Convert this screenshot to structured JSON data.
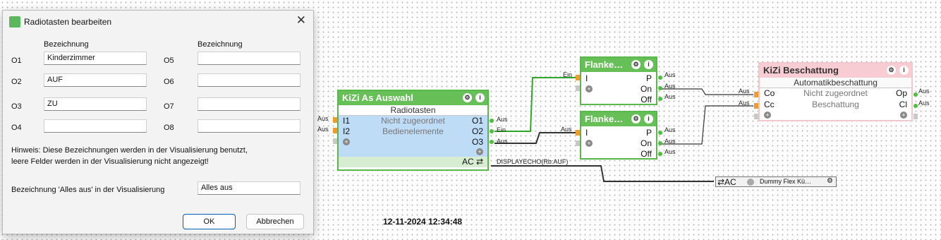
{
  "dialog": {
    "title": "Radiotasten bearbeiten",
    "close": "✕",
    "col_header_left": "Bezeichnung",
    "col_header_right": "Bezeichnung",
    "rows_left": [
      {
        "label": "O1",
        "value": "Kinderzimmer"
      },
      {
        "label": "O2",
        "value": "AUF"
      },
      {
        "label": "O3",
        "value": "ZU"
      },
      {
        "label": "O4",
        "value": ""
      }
    ],
    "rows_right": [
      {
        "label": "O5",
        "value": ""
      },
      {
        "label": "O6",
        "value": ""
      },
      {
        "label": "O7",
        "value": ""
      },
      {
        "label": "O8",
        "value": ""
      }
    ],
    "hint_line1": "Hinweis: Diese Bezeichnungen werden in der Visualisierung benutzt,",
    "hint_line2": "leere Felder werden in der Visualisierung nicht angezeigt!",
    "all_off_label": "Bezeichnung 'Alles aus' in der Visualisierung",
    "all_off_value": "Alles aus",
    "ok_label": "OK",
    "cancel_label": "Abbrechen"
  },
  "blocks": {
    "auswahl": {
      "title": "KiZi As Auswahl",
      "subtitle": "Radiotasten",
      "in1": "I1",
      "in2": "I2",
      "center1": "Nicht zugeordnet",
      "center2": "Bedienelemente",
      "out1": "O1",
      "out2": "O2",
      "out3": "O3",
      "ac": "AC ⇄",
      "ext_in1": "Aus",
      "ext_in2": "Aus",
      "ext_out1": "Aus",
      "ext_out2": "Ein",
      "ext_out3": "Aus",
      "echo": "DISPLAYECHO(Rb:AUF)"
    },
    "flanke1": {
      "title": "Flanke…",
      "in": "I",
      "out1": "P",
      "out2": "On",
      "out3": "Off",
      "ext_in": "Ein",
      "ext_out1": "Aus",
      "ext_out2": "Aus",
      "ext_out3": "Aus"
    },
    "flanke2": {
      "title": "Flanke…",
      "in": "I",
      "out1": "P",
      "out2": "On",
      "out3": "Off",
      "ext_in": "Aus",
      "ext_out1": "Aus",
      "ext_out2": "Aus",
      "ext_out3": "Aus"
    },
    "beschattung": {
      "title": "KiZi Beschattung",
      "subtitle": "Automatikbeschattung",
      "in1": "Co",
      "in2": "Cc",
      "center1": "Nicht zugeordnet",
      "center2": "Beschattung",
      "out1": "Op",
      "out2": "Cl",
      "ext_in1": "Aus",
      "ext_in2": "Aus",
      "ext_out1": "Aus",
      "ext_out2": "Aus"
    },
    "dummy": {
      "ac": "⇄AC",
      "name": "Dummy Flex Kü…"
    }
  },
  "timestamp": "12-11-2024 12:34:48",
  "colors": {
    "block_green": "#67c057",
    "block_pink": "#f7ccd3",
    "selected_blue": "#bfdcf7",
    "pin_orange": "#f39a2d",
    "pin_green": "#4cbf3f",
    "wire_green": "#2fa82a"
  }
}
